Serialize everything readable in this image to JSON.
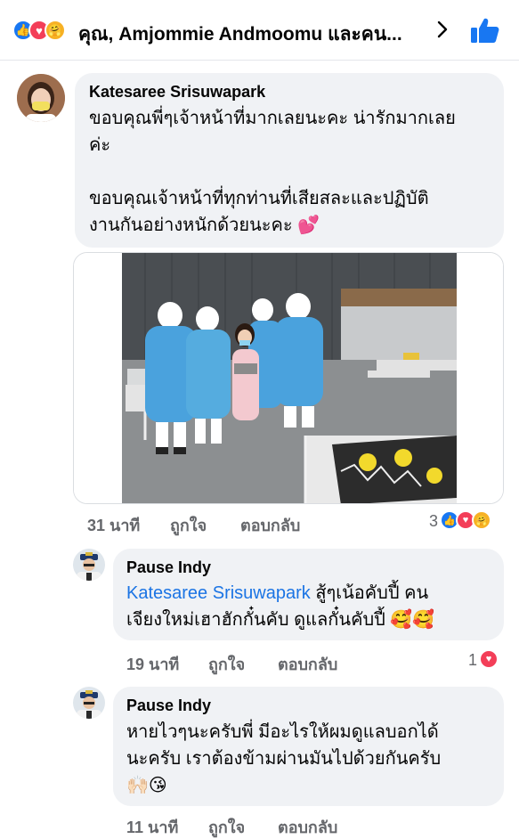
{
  "header": {
    "title": "คุณ, Amjommie Andmoomu และคน...",
    "reactions": [
      "like",
      "love",
      "care"
    ]
  },
  "comments": [
    {
      "author": "Katesaree Srisuwapark",
      "lines": [
        "ขอบคุณพี่ๆเจ้าหน้าที่มากเลยนะคะ น่ารักมากเลย",
        "ค่ะ",
        "",
        "ขอบคุณเจ้าหน้าที่ทุกท่านที่เสียสละและปฏิบัติ",
        "งานกันอย่างหนักด้วยนะคะ 💕"
      ],
      "time": "31 นาที",
      "like_label": "ถูกใจ",
      "reply_label": "ตอบกลับ",
      "reaction_count": "3",
      "reaction_types": [
        "like",
        "love",
        "care"
      ]
    },
    {
      "author": "Pause Indy",
      "mention": "Katesaree Srisuwapark",
      "line1_rest": " สู้ๆเน้อคับปี้ คน",
      "line2": "เจียงใหม่เฮาฮักกั๋นคับ ดูแลกั๋นคับปี้ 🥰🥰",
      "time": "19 นาที",
      "like_label": "ถูกใจ",
      "reply_label": "ตอบกลับ",
      "reaction_count": "1",
      "reaction_types": [
        "love"
      ]
    },
    {
      "author": "Pause Indy",
      "lines": [
        "หายไวๆนะครับพี่ มีอะไรให้ผมดูแลบอกได้",
        "นะครับ เราต้องข้ามผ่านมันไปด้วยกันครับ",
        "🙌🏻😘"
      ],
      "time": "11 นาที",
      "like_label": "ถูกใจ",
      "reply_label": "ตอบกลับ"
    }
  ],
  "colors": {
    "accent": "#1877f2",
    "love": "#f33e58",
    "bubble": "#f0f2f5",
    "meta": "#65676b",
    "mention": "#1b74e4"
  },
  "icons": [
    "like-reaction-icon",
    "love-reaction-icon",
    "care-reaction-icon",
    "chevron-right-icon",
    "thumbs-up-icon"
  ]
}
